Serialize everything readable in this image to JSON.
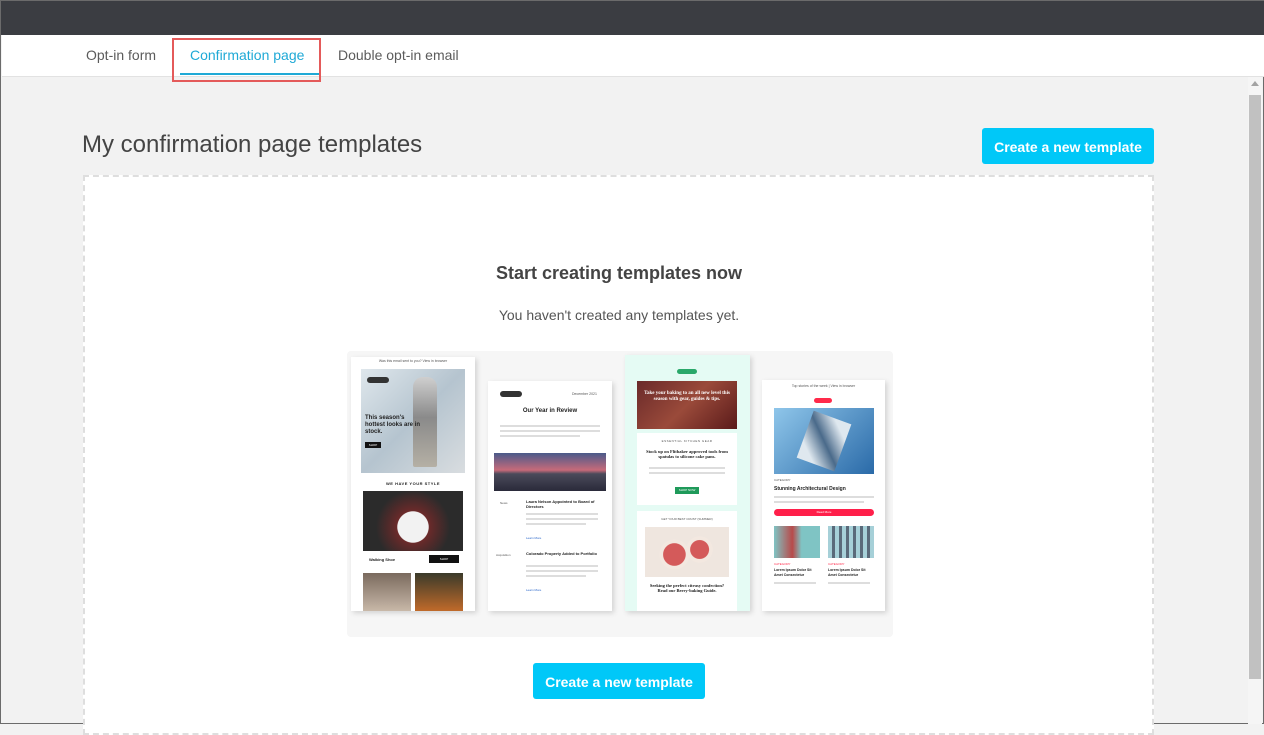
{
  "tabs": [
    {
      "label": "Opt-in form",
      "active": false
    },
    {
      "label": "Confirmation page",
      "active": true
    },
    {
      "label": "Double opt-in email",
      "active": false
    }
  ],
  "page": {
    "title": "My confirmation page templates",
    "create_button": "Create a new template"
  },
  "empty_state": {
    "title": "Start creating templates now",
    "subtitle": "You haven't created any templates yet.",
    "create_button": "Create a new template"
  },
  "previews": {
    "t1": {
      "top_note": "Was this email sent to you? View in browser",
      "hero": "This season's hottest looks are in stock.",
      "hero_btn": "SHOP",
      "section": "WE HAVE YOUR STYLE",
      "product": "Walking Shoe",
      "product_btn": "SHOP"
    },
    "t2": {
      "date": "December 2021",
      "title": "Our Year in Review",
      "item1_label": "News",
      "item1": "Laura Nelson Appointed to Board of Directors",
      "item2_label": "Acquisition",
      "item2": "Colorado Property Added to Portfolio",
      "link": "Learn More"
    },
    "t3": {
      "hero": "Take your baking to an all new level this season with gear, guides & tips.",
      "kicker": "ESSENTIAL KITCHEN GEAR",
      "heading": "Stock up on Flitbaker approved tools from spatulas to silicone cake pans.",
      "btn": "SHOP NOW",
      "kicker2": "GET YOUR BEST CRUST (SUMMER)",
      "heading2": "Seeking the perfect citrusy confection? Read our Berry-baking Guide."
    },
    "t4": {
      "top_note": "Top stories of the week | View in browser",
      "category": "CATEGORY",
      "title": "Stunning Architectural Design",
      "btn": "Read More",
      "cat2": "CATEGORY",
      "card1": "Lorem Ipsum Dolor Sit Amet Consectetur",
      "card2": "Lorem Ipsum Dolor Sit Amet Consectetur"
    }
  },
  "colors": {
    "accent": "#00c8f8",
    "tab_active": "#1fa9d6",
    "highlight": "#e45a5a",
    "topbar": "#3b3d42"
  }
}
